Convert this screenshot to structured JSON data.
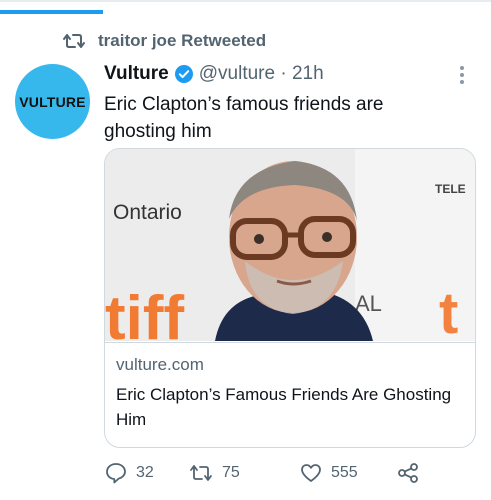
{
  "retweet": {
    "label": "traitor joe Retweeted"
  },
  "tweet": {
    "display_name": "Vulture",
    "handle_time": "@vulture · 21h",
    "text": "Eric Clapton’s famous friends are ghosting him",
    "avatar_text": "VULTURE"
  },
  "card": {
    "domain": "vulture.com",
    "title": "Eric Clapton’s Famous Friends Are Ghosting Him",
    "image_text": {
      "ontario": "Ontario",
      "tiff": "tiff",
      "tel": "TELE",
      "al": "AL"
    }
  },
  "actions": {
    "replies": "32",
    "retweets": "75",
    "likes": "555"
  },
  "colors": {
    "accent": "#1d9bf0",
    "secondary_text": "#536471",
    "tiff_orange": "#f36f21",
    "avatar_bg": "#37b8ec"
  }
}
